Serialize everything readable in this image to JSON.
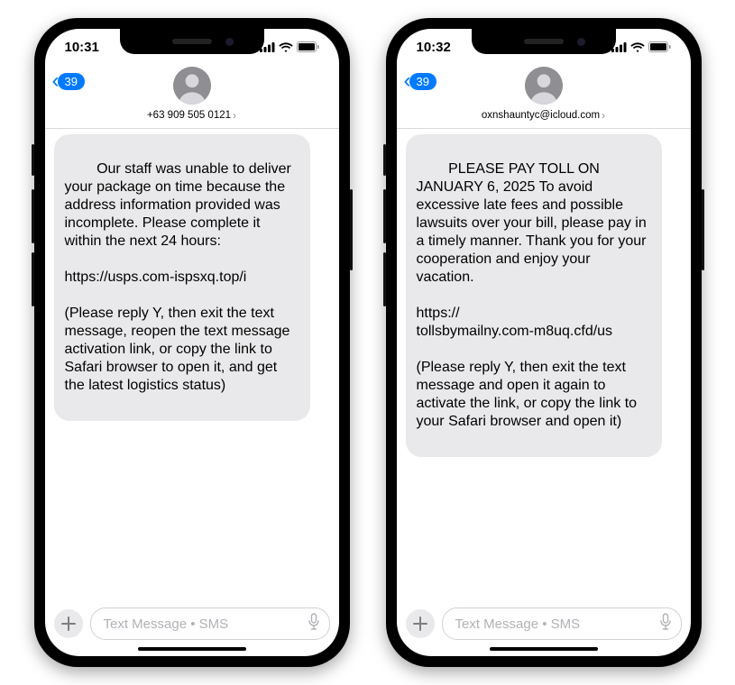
{
  "phones": [
    {
      "time": "10:31",
      "back_count": "39",
      "contact": "+63 909 505 0121",
      "message": "Our staff was unable to deliver your package on time because the address information provided was incomplete. Please complete it\nwithin the next 24 hours:\n\nhttps://usps.com-ispsxq.top/i\n\n(Please reply Y, then exit the text message, reopen the text message activation link, or copy the link to Safari browser to open it, and get the latest logistics status)",
      "placeholder": "Text Message • SMS"
    },
    {
      "time": "10:32",
      "back_count": "39",
      "contact": "oxnshauntyc@icloud.com",
      "message": "PLEASE PAY TOLL ON JANUARY 6, 2025 To avoid excessive late fees and possible lawsuits over your bill, please pay in a timely manner. Thank you for your cooperation and enjoy your vacation.\n\nhttps://\ntollsbymailny.com-m8uq.cfd/us\n\n(Please reply Y, then exit the text message and open it again to activate the link, or copy the link to your Safari browser and open it)",
      "placeholder": "Text Message • SMS"
    }
  ]
}
